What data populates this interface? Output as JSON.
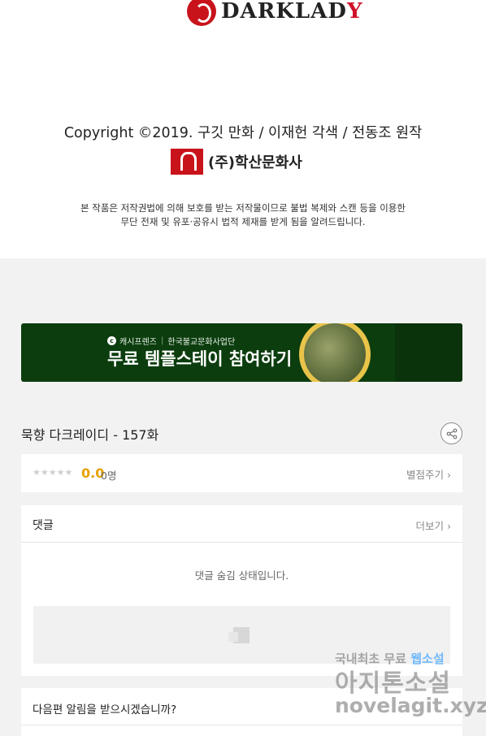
{
  "viewer_footer": {
    "logo_text_dark": "DARKLAD",
    "logo_text_red": "Y",
    "copyright": "Copyright ©2019. 구깃 만화 / 이재헌 각색 / 전동조 원작",
    "publisher": "(주)학산문화사",
    "notice_line1": "본 작품은 저작권법에 의해 보호를 받는 저작물이므로 불법 복제와 스캔 등을 이용한",
    "notice_line2": "무단 전재 및 유포·공유시 법적 제재를 받게 됨을 알려드립니다."
  },
  "banner": {
    "sponsor": "캐시프렌즈",
    "partner": "한국불교문화사업단",
    "title": "무료 템플스테이 참여하기",
    "background_color": "#0c3d0e"
  },
  "episode": {
    "title": "묵향 다크레이디 - 157화",
    "share_icon": "share-icon"
  },
  "rating": {
    "stars": "★★★★★",
    "score": "0.0",
    "count": "0명",
    "rate_link": "별점주기 ›",
    "score_color": "#e8a000"
  },
  "comments": {
    "title": "댓글",
    "more": "더보기 ›",
    "hidden_message": "댓글 숨김 상태입니다."
  },
  "notify": {
    "question": "다음편 알림을 받으시겠습니까?"
  },
  "watermark": {
    "line1_a": "국내최초 무료 ",
    "line1_b": "웹소설",
    "line2": "아지톤소설",
    "line3": "novelagit.xyz"
  }
}
